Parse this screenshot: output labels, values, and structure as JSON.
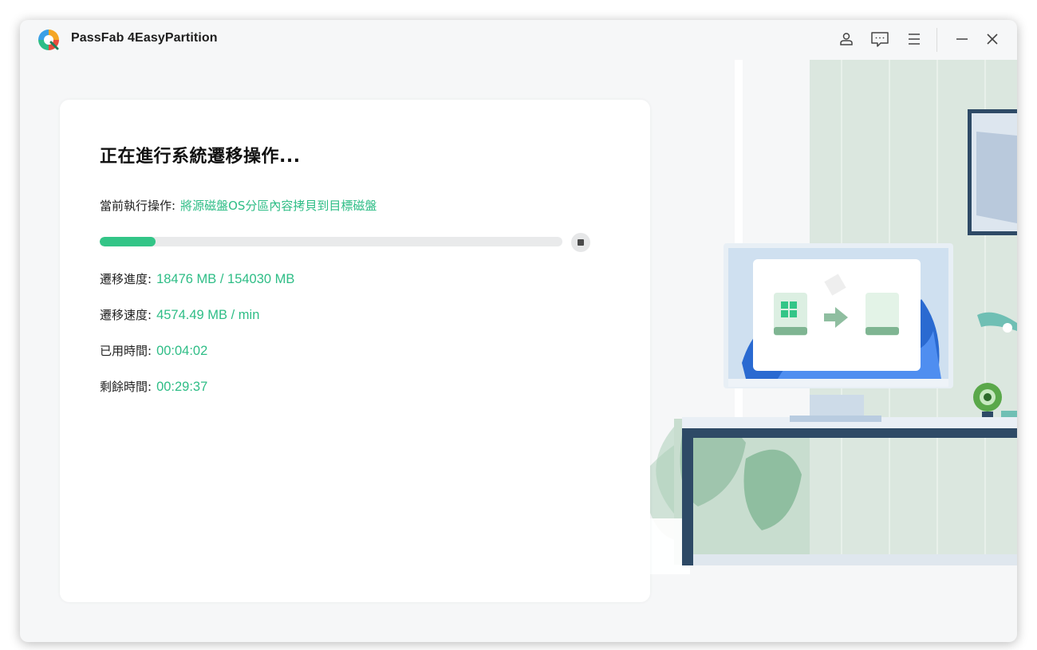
{
  "app": {
    "title": "PassFab 4EasyPartition"
  },
  "titlebar": {
    "icons": [
      "account-icon",
      "feedback-icon",
      "menu-icon",
      "minimize-icon",
      "close-icon"
    ]
  },
  "migration": {
    "heading": "正在進行系統遷移操作...",
    "current_op_label": "當前執行操作:",
    "current_op_value": "將源磁盤OS分區內容拷貝到目標磁盤",
    "progress_fraction": 0.12,
    "stats": [
      {
        "label": "遷移進度:",
        "value": "18476 MB / 154030 MB"
      },
      {
        "label": "遷移速度:",
        "value": "4574.49 MB / min"
      },
      {
        "label": "已用時間:",
        "value": "00:04:02"
      },
      {
        "label": "剩餘時間:",
        "value": "00:29:37"
      }
    ]
  },
  "colors": {
    "accent": "#2ebd86",
    "progress_track": "#e9eaeb",
    "desk_frame": "#2e4a66",
    "wall_green": "#dbe7df"
  }
}
